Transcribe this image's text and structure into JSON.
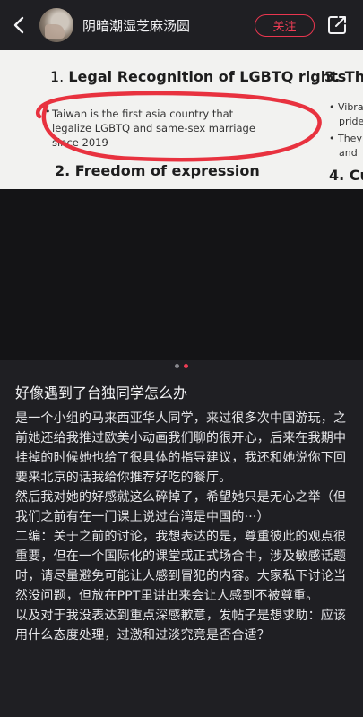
{
  "header": {
    "username": "阴暗潮湿芝麻汤圆",
    "follow_label": "关注",
    "icons": {
      "back": "chevron-left-icon",
      "share": "share-icon"
    }
  },
  "slide": {
    "heading_1": "1. Legal Recognition of LGBTQ rights",
    "heading_1_num": "1.",
    "heading_1_text": "Legal Recognition of LGBTQ rights",
    "heading_3": "3. Thr",
    "bullet_lines": [
      "Taiwan is the first asia country that",
      "legalize LGBTQ and same-sex marriage",
      "since 2019"
    ],
    "right_bullets": [
      "• Vibra",
      "pride",
      "• They",
      "and"
    ],
    "heading_2": "2.  Freedom of expression",
    "heading_4": "4. Cu"
  },
  "carousel": {
    "count": 2,
    "active_index": 1
  },
  "post": {
    "title": "好像遇到了台独同学怎么办",
    "paragraphs": [
      "是一个小组的马来西亚华人同学，来过很多次中国游玩，之前她还给我推过欧美小动画我们聊的很开心，后来在我期中挂掉的时候她也给了很具体的指导建议，我还和她说你下回要来北京的话我给你推荐好吃的餐厅。",
      "然后我对她的好感就这么碎掉了，希望她只是无心之举（但我们之前有在一门课上说过台湾是中国的···）",
      "二编：关于之前的讨论，我想表达的是，尊重彼此的观点很重要，但在一个国际化的课堂或正式场合中，涉及敏感话题时，请尽量避免可能让人感到冒犯的内容。大家私下讨论当然没问题，但放在PPT里讲出来会让人感到不被尊重。",
      "以及对于我没表达到重点深感歉意，发帖子是想求助：应该用什么态度处理，过激和过淡究竟是否合适？"
    ]
  },
  "colors": {
    "accent": "#ef3d55",
    "background": "#1f1f23",
    "circle": "#e8323f"
  }
}
